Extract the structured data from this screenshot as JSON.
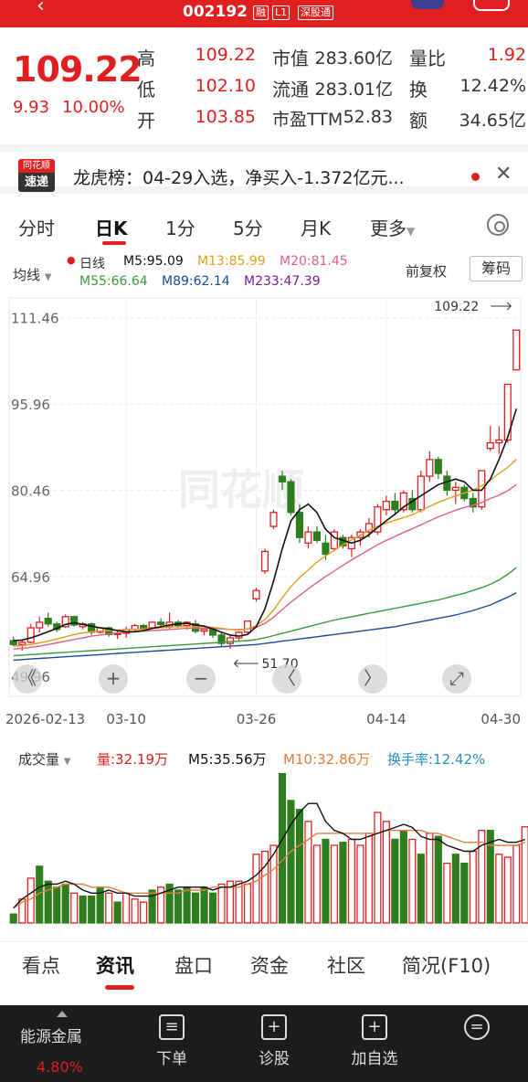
{
  "header": {
    "code": "002192",
    "tag_margin": "融",
    "tag_level": "L1",
    "tag_connect": "深股通"
  },
  "quote": {
    "price": "109.22",
    "change": "9.93",
    "change_pct": "10.00%",
    "high_label": "高",
    "high": "109.22",
    "low_label": "低",
    "low": "102.10",
    "open_label": "开",
    "open": "103.85",
    "mktcap_label": "市值",
    "mktcap": "283.60亿",
    "float_label": "流通",
    "float": "283.01亿",
    "pe_label": "市盈TTM",
    "pe": "52.83",
    "volratio_label": "量比",
    "volratio": "1.92",
    "turnover_label": "换",
    "turnover": "12.42%",
    "amount_label": "额",
    "amount": "34.65亿"
  },
  "banner": {
    "logo_top": "同花顺",
    "logo_bottom": "速递",
    "text": "龙虎榜：04-29入选，净买入-1.372亿元..."
  },
  "tabs": [
    "分时",
    "日K",
    "1分",
    "5分",
    "月K",
    "更多"
  ],
  "active_tab": "日K",
  "ma_legend": {
    "selector": "均线",
    "daily": "日线",
    "m5": "M5:95.09",
    "m13": "M13:85.99",
    "m20": "M20:81.45",
    "m55": "M55:66.64",
    "m89": "M89:62.14",
    "m233": "M233:47.39",
    "adj": "前复权",
    "chip": "筹码"
  },
  "vol_legend": {
    "selector": "成交量",
    "vol": "量:32.19万",
    "m5": "M5:35.56万",
    "m10": "M10:32.86万",
    "turnover": "换手率:12.42%"
  },
  "colors": {
    "up": "#e02020",
    "down": "#2e7d1e",
    "m5": "#111111",
    "m13": "#e0a020",
    "m20": "#e06080",
    "m55": "#3a9a3a",
    "m89": "#1a4a9a",
    "m233": "#7a1a9a",
    "vol_m5": "#111111",
    "vol_m10": "#e08040"
  },
  "chart_data": {
    "type": "candlestick",
    "ylim": [
      43.5,
      115
    ],
    "yticks": [
      "111.46",
      "95.96",
      "80.46",
      "64.96"
    ],
    "ytick_values": [
      111.46,
      95.96,
      80.46,
      64.96
    ],
    "bottom_tick": "49.96",
    "xticks": [
      "2026-02-13",
      "03-10",
      "03-26",
      "04-14",
      "04-30"
    ],
    "xtick_index": [
      0,
      13,
      28,
      43,
      58
    ],
    "max_label": "109.22",
    "min_label": "51.70",
    "candles": [
      [
        53.5,
        54.2,
        52.5,
        52.8
      ],
      [
        52.8,
        53.6,
        51.7,
        53.2
      ],
      [
        53.2,
        56.5,
        53.0,
        55.8
      ],
      [
        55.8,
        57.8,
        55.0,
        56.8
      ],
      [
        57.5,
        58.5,
        56.0,
        56.5
      ],
      [
        56.5,
        56.9,
        55.0,
        55.5
      ],
      [
        56.0,
        58.2,
        55.8,
        57.8
      ],
      [
        57.8,
        58.0,
        56.0,
        56.3
      ],
      [
        56.0,
        56.8,
        55.5,
        56.5
      ],
      [
        56.5,
        56.8,
        54.5,
        55.0
      ],
      [
        55.0,
        56.0,
        54.8,
        55.8
      ],
      [
        55.8,
        56.0,
        54.2,
        54.6
      ],
      [
        54.6,
        55.2,
        53.8,
        54.8
      ],
      [
        54.8,
        56.0,
        54.0,
        55.5
      ],
      [
        55.5,
        56.5,
        55.0,
        56.2
      ],
      [
        56.2,
        56.5,
        55.2,
        55.8
      ],
      [
        55.8,
        57.0,
        55.5,
        56.8
      ],
      [
        56.8,
        57.5,
        56.0,
        56.4
      ],
      [
        56.0,
        58.5,
        55.5,
        56.8
      ],
      [
        56.8,
        57.2,
        55.8,
        56.2
      ],
      [
        56.2,
        57.0,
        55.5,
        56.8
      ],
      [
        56.5,
        57.2,
        54.8,
        55.2
      ],
      [
        55.2,
        55.8,
        54.5,
        55.5
      ],
      [
        55.5,
        55.8,
        54.0,
        54.5
      ],
      [
        54.5,
        55.0,
        52.5,
        53.0
      ],
      [
        53.0,
        54.5,
        52.0,
        54.0
      ],
      [
        54.0,
        55.2,
        53.5,
        55.0
      ],
      [
        55.0,
        57.0,
        54.8,
        57.0
      ],
      [
        61.0,
        63.0,
        60.5,
        62.5
      ],
      [
        66.0,
        70.0,
        65.5,
        69.5
      ],
      [
        74.0,
        77.0,
        73.5,
        76.5
      ],
      [
        83.0,
        84.0,
        80.5,
        82.0
      ],
      [
        82.0,
        82.5,
        76.0,
        76.5
      ],
      [
        76.5,
        78.0,
        71.0,
        72.0
      ],
      [
        71.0,
        74.0,
        70.0,
        73.0
      ],
      [
        73.0,
        74.0,
        71.0,
        71.5
      ],
      [
        71.0,
        72.5,
        68.0,
        69.0
      ],
      [
        70.0,
        73.5,
        69.5,
        73.0
      ],
      [
        72.0,
        72.5,
        70.0,
        70.5
      ],
      [
        70.0,
        72.5,
        68.5,
        72.0
      ],
      [
        72.0,
        73.5,
        70.5,
        73.0
      ],
      [
        73.0,
        75.5,
        72.0,
        74.5
      ],
      [
        73.0,
        78.0,
        72.5,
        77.5
      ],
      [
        77.0,
        79.5,
        76.0,
        78.5
      ],
      [
        78.5,
        80.0,
        76.0,
        77.0
      ],
      [
        77.0,
        80.5,
        76.5,
        80.0
      ],
      [
        79.0,
        80.5,
        76.5,
        77.0
      ],
      [
        77.0,
        84.0,
        76.5,
        83.0
      ],
      [
        83.0,
        87.5,
        82.0,
        86.0
      ],
      [
        86.0,
        86.5,
        82.5,
        83.5
      ],
      [
        83.0,
        84.0,
        79.5,
        80.5
      ],
      [
        80.5,
        82.0,
        78.0,
        81.0
      ],
      [
        81.0,
        81.5,
        78.5,
        79.0
      ],
      [
        79.0,
        80.0,
        76.5,
        77.5
      ],
      [
        77.5,
        84.0,
        77.0,
        84.0
      ],
      [
        88.0,
        92.0,
        87.5,
        89.0
      ],
      [
        89.0,
        92.0,
        87.0,
        89.5
      ],
      [
        89.5,
        99.5,
        89.0,
        99.5
      ],
      [
        102.1,
        109.22,
        102.1,
        109.22
      ]
    ],
    "ma5": [
      53.5,
      53.6,
      54.0,
      54.5,
      55.1,
      55.7,
      56.4,
      56.7,
      56.4,
      56.1,
      55.8,
      55.6,
      55.3,
      55.1,
      55.1,
      55.3,
      55.7,
      56.0,
      56.3,
      56.5,
      56.6,
      56.3,
      56.1,
      55.6,
      55.0,
      54.5,
      54.3,
      54.6,
      56.0,
      59.2,
      64.2,
      70.0,
      75.0,
      77.0,
      78.0,
      76.5,
      73.5,
      72.0,
      71.5,
      71.0,
      71.5,
      72.5,
      73.8,
      75.0,
      76.2,
      77.5,
      78.5,
      79.5,
      80.5,
      81.5,
      82.0,
      82.5,
      82.0,
      80.5,
      80.5,
      82.5,
      86.0,
      90.0,
      95.1
    ],
    "ma13": [
      52.5,
      52.6,
      52.8,
      53.1,
      53.4,
      53.8,
      54.2,
      54.6,
      54.9,
      55.1,
      55.2,
      55.3,
      55.4,
      55.5,
      55.5,
      55.6,
      55.7,
      55.8,
      55.9,
      56.0,
      56.0,
      56.0,
      56.0,
      55.9,
      55.7,
      55.5,
      55.4,
      55.6,
      56.2,
      57.3,
      59.0,
      61.2,
      63.2,
      64.8,
      66.2,
      67.6,
      68.7,
      69.7,
      70.7,
      71.6,
      72.4,
      73.3,
      74.0,
      74.6,
      75.1,
      75.6,
      76.1,
      76.8,
      77.6,
      78.3,
      78.9,
      79.5,
      80.0,
      80.5,
      81.3,
      82.3,
      83.5,
      84.6,
      86.0
    ],
    "ma20": [
      52.0,
      52.1,
      52.3,
      52.5,
      52.8,
      53.1,
      53.4,
      53.7,
      54.0,
      54.3,
      54.5,
      54.7,
      54.9,
      55.0,
      55.1,
      55.2,
      55.3,
      55.4,
      55.5,
      55.6,
      55.7,
      55.7,
      55.7,
      55.7,
      55.6,
      55.5,
      55.5,
      55.6,
      55.9,
      56.6,
      57.7,
      59.1,
      60.4,
      61.6,
      62.8,
      63.9,
      65.0,
      66.0,
      67.0,
      68.0,
      68.9,
      69.8,
      70.7,
      71.5,
      72.2,
      72.9,
      73.6,
      74.3,
      75.0,
      75.7,
      76.3,
      76.9,
      77.4,
      77.8,
      78.3,
      79.0,
      79.6,
      80.4,
      81.5
    ],
    "ma55": [
      50.8,
      50.9,
      51.0,
      51.1,
      51.2,
      51.3,
      51.4,
      51.5,
      51.6,
      51.7,
      51.8,
      51.9,
      52.0,
      52.1,
      52.2,
      52.3,
      52.4,
      52.5,
      52.6,
      52.7,
      52.8,
      52.9,
      53.0,
      53.1,
      53.2,
      53.3,
      53.4,
      53.5,
      53.7,
      54.0,
      54.4,
      54.8,
      55.2,
      55.6,
      56.0,
      56.4,
      56.8,
      57.2,
      57.5,
      57.8,
      58.1,
      58.4,
      58.7,
      59.0,
      59.3,
      59.6,
      59.9,
      60.2,
      60.5,
      60.8,
      61.2,
      61.6,
      62.0,
      62.5,
      63.0,
      63.6,
      64.4,
      65.4,
      66.6
    ],
    "ma89": [
      50.0,
      50.1,
      50.2,
      50.3,
      50.4,
      50.5,
      50.6,
      50.7,
      50.8,
      50.9,
      51.0,
      51.1,
      51.2,
      51.3,
      51.4,
      51.5,
      51.6,
      51.7,
      51.8,
      51.9,
      52.0,
      52.1,
      52.2,
      52.3,
      52.4,
      52.5,
      52.6,
      52.7,
      52.8,
      53.0,
      53.2,
      53.4,
      53.6,
      53.8,
      54.0,
      54.2,
      54.4,
      54.6,
      54.8,
      55.0,
      55.2,
      55.4,
      55.6,
      55.8,
      56.0,
      56.3,
      56.6,
      56.9,
      57.2,
      57.5,
      57.8,
      58.1,
      58.5,
      58.9,
      59.4,
      59.9,
      60.6,
      61.3,
      62.1
    ],
    "volume": [
      [
        3,
        0
      ],
      [
        8,
        1
      ],
      [
        15,
        1
      ],
      [
        19,
        0
      ],
      [
        14,
        0
      ],
      [
        12,
        0
      ],
      [
        13,
        0
      ],
      [
        10,
        1
      ],
      [
        9,
        0
      ],
      [
        9,
        0
      ],
      [
        12,
        0
      ],
      [
        10,
        1
      ],
      [
        7,
        0
      ],
      [
        10,
        1
      ],
      [
        8,
        1
      ],
      [
        7,
        1
      ],
      [
        11,
        0
      ],
      [
        12,
        1
      ],
      [
        13,
        0
      ],
      [
        11,
        0
      ],
      [
        12,
        0
      ],
      [
        10,
        0
      ],
      [
        12,
        0
      ],
      [
        10,
        0
      ],
      [
        13,
        1
      ],
      [
        14,
        1
      ],
      [
        14,
        1
      ],
      [
        13,
        1
      ],
      [
        23,
        1
      ],
      [
        24,
        1
      ],
      [
        26,
        1
      ],
      [
        50,
        0
      ],
      [
        41,
        0
      ],
      [
        38,
        0
      ],
      [
        34,
        1
      ],
      [
        26,
        1
      ],
      [
        28,
        0
      ],
      [
        26,
        1
      ],
      [
        27,
        0
      ],
      [
        28,
        1
      ],
      [
        26,
        1
      ],
      [
        30,
        1
      ],
      [
        37,
        1
      ],
      [
        34,
        1
      ],
      [
        28,
        0
      ],
      [
        31,
        0
      ],
      [
        28,
        1
      ],
      [
        23,
        0
      ],
      [
        30,
        1
      ],
      [
        29,
        0
      ],
      [
        20,
        1
      ],
      [
        23,
        0
      ],
      [
        20,
        0
      ],
      [
        24,
        1
      ],
      [
        31,
        1
      ],
      [
        31,
        0
      ],
      [
        23,
        1
      ],
      [
        22,
        1
      ],
      [
        26,
        1
      ],
      [
        32.19,
        1
      ]
    ],
    "vol_ma5": [
      5,
      8,
      10,
      12,
      13,
      13,
      14,
      13,
      11,
      10,
      10,
      11,
      10,
      10,
      9,
      9,
      9,
      10,
      11,
      12,
      12,
      12,
      12,
      11,
      12,
      12,
      13,
      14,
      16,
      19,
      23,
      28,
      33,
      37,
      40,
      40,
      34,
      31,
      30,
      28,
      28,
      29,
      30,
      31,
      32,
      33,
      32,
      29,
      28,
      28,
      26,
      25,
      24,
      24,
      26,
      27,
      28,
      27,
      27,
      28
    ],
    "vol_ma10": [
      5,
      7,
      8,
      10,
      11,
      12,
      13,
      13,
      13,
      12,
      12,
      12,
      11,
      10,
      10,
      10,
      10,
      10,
      10,
      10,
      11,
      11,
      11,
      12,
      12,
      12,
      12,
      13,
      14,
      16,
      18,
      21,
      24,
      26,
      28,
      30,
      30,
      30,
      30,
      30,
      30,
      30,
      30,
      31,
      31,
      31,
      31,
      31,
      30,
      30,
      29,
      28,
      27,
      27,
      27,
      26,
      26,
      26,
      26,
      27
    ]
  },
  "nav_buttons": [
    "《",
    "+",
    "−",
    "〈",
    "〉",
    "⤢"
  ],
  "content_tabs": [
    "看点",
    "资讯",
    "盘口",
    "资金",
    "社区",
    "简况(F10)"
  ],
  "active_content_tab": "资讯",
  "footer": {
    "sector": "能源金属",
    "sector_pct": "4.80%",
    "items": [
      "下单",
      "诊股",
      "加自选"
    ]
  }
}
